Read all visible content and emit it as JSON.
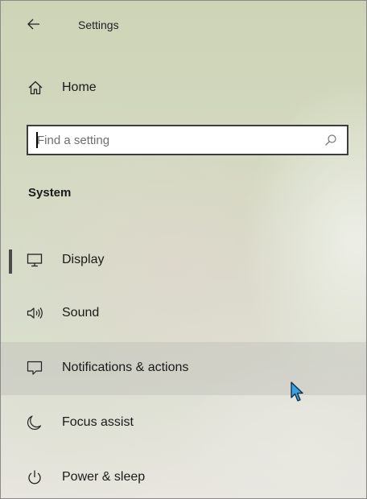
{
  "window": {
    "title": "Settings"
  },
  "home": {
    "label": "Home"
  },
  "search": {
    "placeholder": "Find a setting",
    "value": ""
  },
  "section": {
    "title": "System"
  },
  "nav": {
    "items": [
      {
        "label": "Display",
        "icon": "monitor-icon",
        "active": true
      },
      {
        "label": "Sound",
        "icon": "speaker-icon"
      },
      {
        "label": "Notifications & actions",
        "icon": "notification-icon",
        "hovered": true
      },
      {
        "label": "Focus assist",
        "icon": "moon-icon"
      },
      {
        "label": "Power & sleep",
        "icon": "power-icon"
      }
    ]
  },
  "colors": {
    "text": "#1a1a1a",
    "active_indicator": "#4a4a4a",
    "search_border": "#3d3d3d",
    "cursor": "#3aa0e0"
  }
}
